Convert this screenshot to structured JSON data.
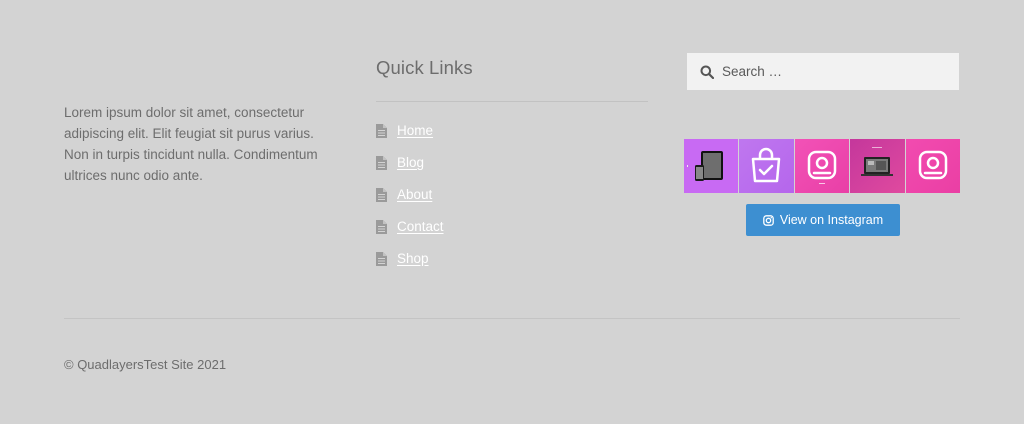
{
  "about": {
    "text": "Lorem ipsum dolor sit amet, consectetur adipiscing elit. Elit feugiat sit purus varius. Non in turpis tincidunt nulla. Condimentum ultrices nunc odio ante."
  },
  "quick_links": {
    "title": "Quick Links",
    "items": [
      {
        "label": "Home",
        "icon": "document-icon"
      },
      {
        "label": "Blog",
        "icon": "document-icon"
      },
      {
        "label": "About",
        "icon": "document-icon"
      },
      {
        "label": "Contact",
        "icon": "document-icon"
      },
      {
        "label": "Shop",
        "icon": "document-icon"
      }
    ]
  },
  "search": {
    "placeholder": "Search …",
    "icon": "search-icon"
  },
  "instagram": {
    "button_label": "View on Instagram",
    "button_icon": "instagram-icon",
    "tiles": [
      "devices-image",
      "shopping-bag-image",
      "instagram-logo-image",
      "laptop-mockup-image",
      "instagram-logo-image"
    ]
  },
  "footer": {
    "copyright": "© QuadlayersTest Site 2021"
  },
  "colors": {
    "background": "#d3d3d3",
    "link": "#ffffff",
    "button": "#3d8fd1",
    "search_bg": "#f2f2f2"
  }
}
